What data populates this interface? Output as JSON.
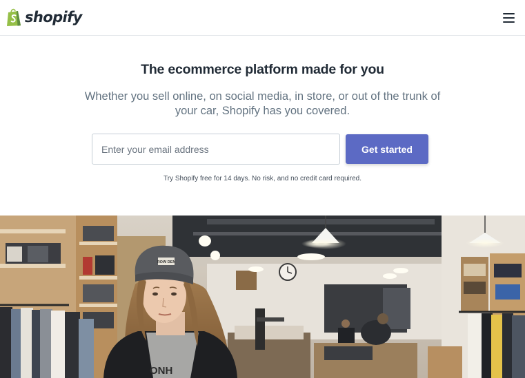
{
  "header": {
    "brand_name": "shopify",
    "logo_icon": "shopify-bag-icon",
    "menu_icon": "hamburger-menu-icon"
  },
  "hero": {
    "headline": "The ecommerce platform made for you",
    "subheadline": "Whether you sell online, on social media, in store, or out of the trunk of your car, Shopify has you covered.",
    "email_placeholder": "Enter your email address",
    "email_value": "",
    "cta_label": "Get started",
    "trial_note": "Try Shopify free for 14 days. No risk, and no credit card required."
  },
  "photo": {
    "beanie_patch_text": "ROW DEN",
    "shirt_text": "ONH"
  },
  "colors": {
    "accent": "#5c6ac4",
    "brand_green": "#95bf47",
    "heading": "#212b36",
    "body_text": "#637381"
  }
}
